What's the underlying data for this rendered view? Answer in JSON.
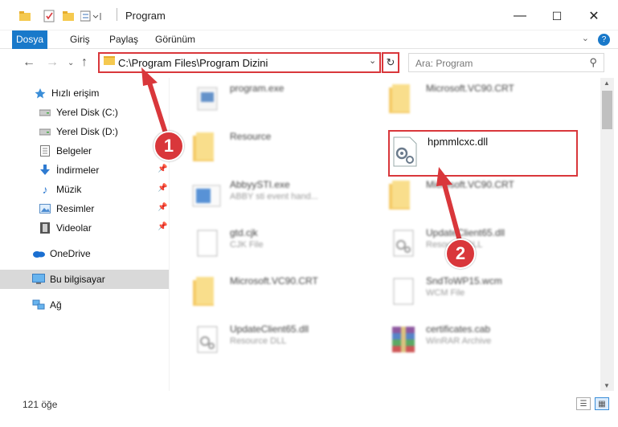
{
  "window": {
    "title": "Program",
    "controls": {
      "minimize": "—",
      "maximize": "☐",
      "close": "✕"
    }
  },
  "ribbon": {
    "tabs": [
      "Dosya",
      "Giriş",
      "Paylaş",
      "Görünüm"
    ],
    "help": "?"
  },
  "address": {
    "path": "C:\\Program Files\\Program Dizini",
    "refresh_icon": "↻"
  },
  "search": {
    "placeholder": "Ara: Program"
  },
  "nav_pane": {
    "quick_access": "Hızlı erişim",
    "items": [
      {
        "label": "Yerel Disk (C:)",
        "icon": "drive-icon",
        "pinned": true
      },
      {
        "label": "Yerel Disk (D:)",
        "icon": "drive-icon",
        "pinned": true
      },
      {
        "label": "Belgeler",
        "icon": "documents-icon",
        "pinned": true
      },
      {
        "label": "İndirmeler",
        "icon": "download-icon",
        "pinned": true
      },
      {
        "label": "Müzik",
        "icon": "music-icon",
        "pinned": true
      },
      {
        "label": "Resimler",
        "icon": "pictures-icon",
        "pinned": true
      },
      {
        "label": "Videolar",
        "icon": "videos-icon",
        "pinned": true
      }
    ],
    "onedrive": "OneDrive",
    "this_pc": "Bu bilgisayar",
    "network": "Ağ"
  },
  "files": {
    "left_column": [
      {
        "name": "program.exe",
        "sub": "",
        "icon": "exe-icon"
      },
      {
        "name": "Resource",
        "sub": "",
        "icon": "folder-icon"
      },
      {
        "name": "AbbyySTI.exe",
        "sub": "ABBY sti event hand...",
        "icon": "exe-icon"
      },
      {
        "name": "gtd.cjk",
        "sub": "CJK File",
        "icon": "file-icon"
      },
      {
        "name": "Microsoft.VC90.CRT",
        "sub": "",
        "icon": "folder-icon"
      },
      {
        "name": "UpdateClient65.dll",
        "sub": "Resource DLL",
        "icon": "dll-icon"
      }
    ],
    "right_column": [
      {
        "name": "Microsoft.VC90.CRT",
        "sub": "",
        "icon": "folder-icon"
      },
      {
        "name": "hpmmlcxc.dll",
        "sub": "",
        "icon": "dll-icon"
      },
      {
        "name": "Microsoft.VC90.CRT",
        "sub": "",
        "icon": "folder-icon"
      },
      {
        "name": "UpdateClient65.dll",
        "sub": "Resource DLL",
        "icon": "dll-icon"
      },
      {
        "name": "SndToWP15.wcm",
        "sub": "WCM File",
        "icon": "file-icon"
      },
      {
        "name": "certificates.cab",
        "sub": "WinRAR Archive",
        "icon": "archive-icon"
      }
    ]
  },
  "status": {
    "count": "121 öğe"
  },
  "annotations": {
    "badge1": "1",
    "badge2": "2",
    "color": "#d9373b"
  }
}
